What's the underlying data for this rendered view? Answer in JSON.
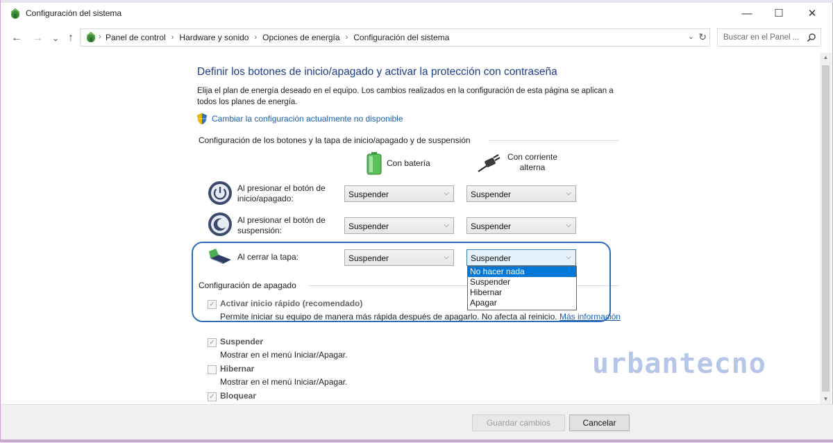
{
  "window": {
    "title": "Configuración del sistema",
    "minimize_glyph": "—",
    "maximize_glyph": "☐",
    "close_glyph": "✕"
  },
  "nav": {
    "back_glyph": "←",
    "forward_glyph": "→",
    "recent_glyph": "⌄",
    "up_glyph": "↑"
  },
  "address": {
    "crumbs": [
      "Panel de control",
      "Hardware y sonido",
      "Opciones de energía",
      "Configuración del sistema"
    ],
    "dropdown_glyph": "⌄",
    "refresh_glyph": "↻"
  },
  "search": {
    "placeholder": "Buscar en el Panel ...",
    "icon": "search-icon"
  },
  "main": {
    "heading": "Definir los botones de inicio/apagado y activar la protección con contraseña",
    "description": "Elija el plan de energía deseado en el equipo. Los cambios realizados en la configuración de esta página se aplican a todos los planes de energía.",
    "change_link": "Cambiar la configuración actualmente no disponible",
    "section_buttons": "Configuración de los botones y la tapa de inicio/apagado y de suspensión",
    "col_battery": "Con batería",
    "col_ac": "Con corriente alterna",
    "rows": [
      {
        "label": "Al presionar el botón de inicio/apagado:",
        "battery": "Suspender",
        "ac": "Suspender"
      },
      {
        "label": "Al presionar el botón de suspensión:",
        "battery": "Suspender",
        "ac": "Suspender"
      },
      {
        "label": "Al cerrar la tapa:",
        "battery": "Suspender",
        "ac": "Suspender"
      }
    ],
    "dropdown_options": [
      "No hacer nada",
      "Suspender",
      "Hibernar",
      "Apagar"
    ],
    "dropdown_highlighted": "No hacer nada",
    "section_shutdown": "Configuración de apagado",
    "shutdown_items": [
      {
        "label": "Activar inicio rápido (recomendado)",
        "checked": true,
        "desc": "Permite iniciar su equipo de manera más rápida después de apagarlo. No afecta al reinicio.",
        "link": "Más información"
      },
      {
        "label": "Suspender",
        "checked": true,
        "desc": "Mostrar en el menú Iniciar/Apagar."
      },
      {
        "label": "Hibernar",
        "checked": false,
        "desc": "Mostrar en el menú Iniciar/Apagar."
      },
      {
        "label": "Bloquear",
        "checked": true
      }
    ],
    "check_glyph": "✓",
    "dd_arrow": "⌵"
  },
  "watermark": "urbantecno",
  "footer": {
    "save_label": "Guardar cambios",
    "cancel_label": "Cancelar"
  },
  "colors": {
    "heading": "#1e3d8a",
    "link": "#1a5fb4",
    "highlight": "#2a6db8",
    "selection": "#0078d7"
  }
}
